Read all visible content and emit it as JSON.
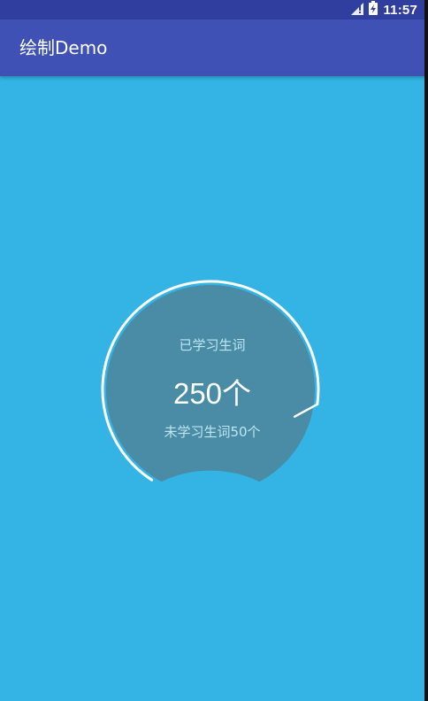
{
  "status_bar": {
    "time": "11:57",
    "icons": [
      "signal-icon",
      "battery-charging-icon"
    ]
  },
  "app_bar": {
    "title": "绘制Demo",
    "color": "#3F51B5"
  },
  "colors": {
    "status_bar": "#303F9F",
    "background": "#33B4E4",
    "gauge_fill": "#4A8BA5",
    "gauge_arc": "#FFFFFF"
  },
  "gauge": {
    "learned_label": "已学习生词",
    "learned_value": "250个",
    "unlearned_label": "未学习生词50个",
    "progress": 0.833
  }
}
